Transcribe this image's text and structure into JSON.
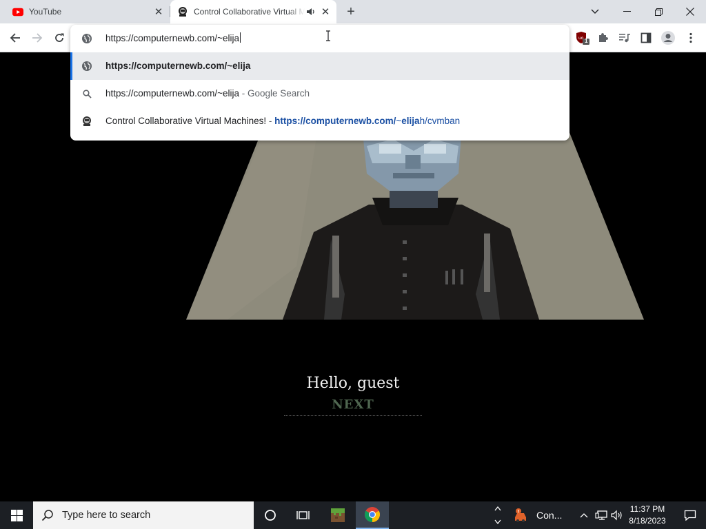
{
  "browser": {
    "tabs": [
      {
        "title": "YouTube",
        "icon": "youtube-icon",
        "active": false
      },
      {
        "title": "Control Collaborative Virtual Machines!",
        "icon": "computernewb-icon",
        "active": true,
        "audio": "speaker-icon"
      }
    ],
    "new_tab_label": "+",
    "window_controls": {
      "dropdown": "⌄",
      "minimize": "—",
      "maximize": "❐",
      "close": "✕"
    }
  },
  "omnibox": {
    "input_value": "https://computernewb.com/~elija",
    "suggestions": [
      {
        "icon": "globe-icon",
        "url_bold": "https://computernewb.com/~elija"
      },
      {
        "icon": "search-icon",
        "query": "https://computernewb.com/~elija",
        "separator": " - ",
        "engine": "Google Search"
      },
      {
        "icon": "computernewb-icon",
        "title": "Control Collaborative Virtual Machines!",
        "separator": " - ",
        "url_bold_1": "https://computernewb.com/",
        "url_plain_1": "~",
        "url_bold_2": "elija",
        "url_plain_2": "h/cvmban"
      }
    ]
  },
  "extensions": {
    "ublock_badge": "1"
  },
  "page": {
    "greeting": "Hello, guest",
    "next_label": "NEXT"
  },
  "taskbar": {
    "search_placeholder": "Type here to search",
    "notification_app": "Con...",
    "time": "11:37 PM",
    "date": "8/18/2023"
  },
  "colors": {
    "accent": "#1a73e8",
    "url_link": "#1a4fa3",
    "next_text": "#4f6650",
    "taskbar": "#1c1f24"
  }
}
